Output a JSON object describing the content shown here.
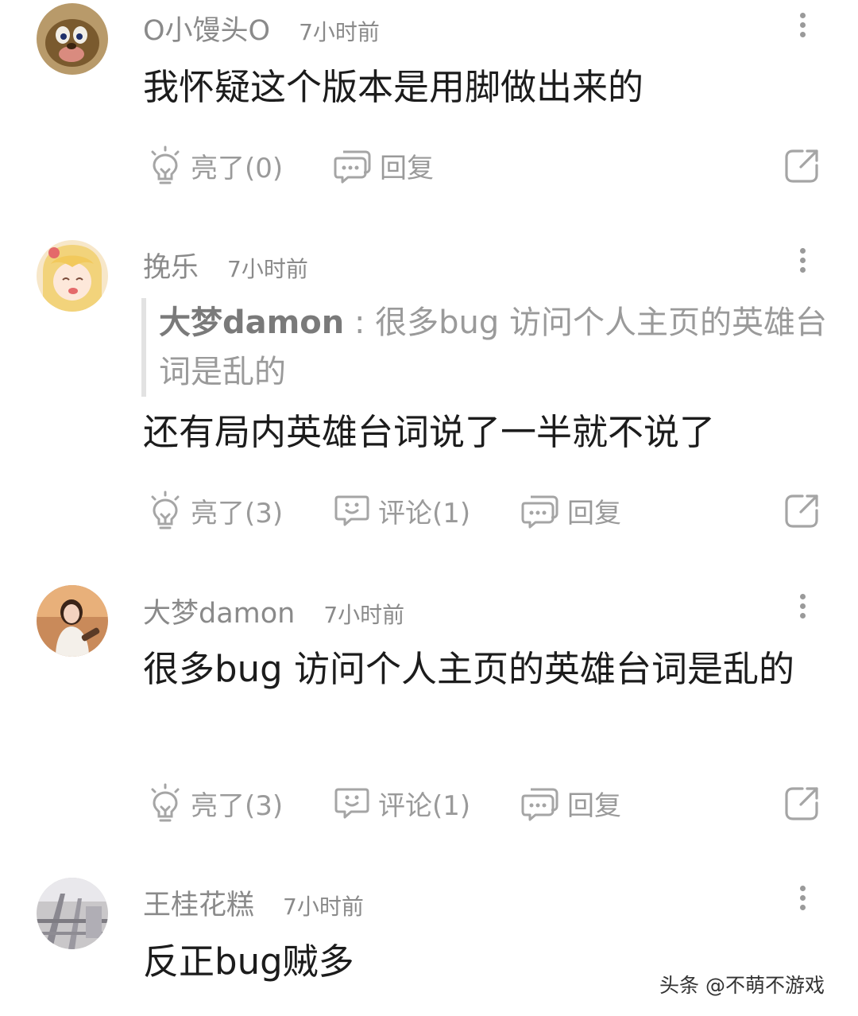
{
  "comments": [
    {
      "username": "O小馒头O",
      "time": "7小时前",
      "text": "我怀疑这个版本是用脚做出来的",
      "actions": {
        "like": "亮了(0)",
        "reply": "回复"
      }
    },
    {
      "username": "挽乐",
      "time": "7小时前",
      "quote": {
        "author": "大梦damon",
        "separator": " : ",
        "text": "很多bug 访问个人主页的英雄台词是乱的"
      },
      "text": "还有局内英雄台词说了一半就不说了",
      "actions": {
        "like": "亮了(3)",
        "comment": "评论(1)",
        "reply": "回复"
      }
    },
    {
      "username": "大梦damon",
      "time": "7小时前",
      "text": "很多bug 访问个人主页的英雄台词是乱的",
      "actions": {
        "like": "亮了(3)",
        "comment": "评论(1)",
        "reply": "回复"
      }
    },
    {
      "username": "王桂花糕",
      "time": "7小时前",
      "text": "反正bug贼多"
    }
  ],
  "watermark": "头条 @不萌不游戏",
  "icons": {
    "like": "lightbulb-icon",
    "comment": "comment-bubble-icon",
    "reply": "reply-bubble-icon",
    "share": "share-icon",
    "more": "more-vertical-icon"
  },
  "colors": {
    "meta_text": "#8a8a8a",
    "body_text": "#1c1c1c",
    "quote_bar": "#e2e2e2"
  }
}
